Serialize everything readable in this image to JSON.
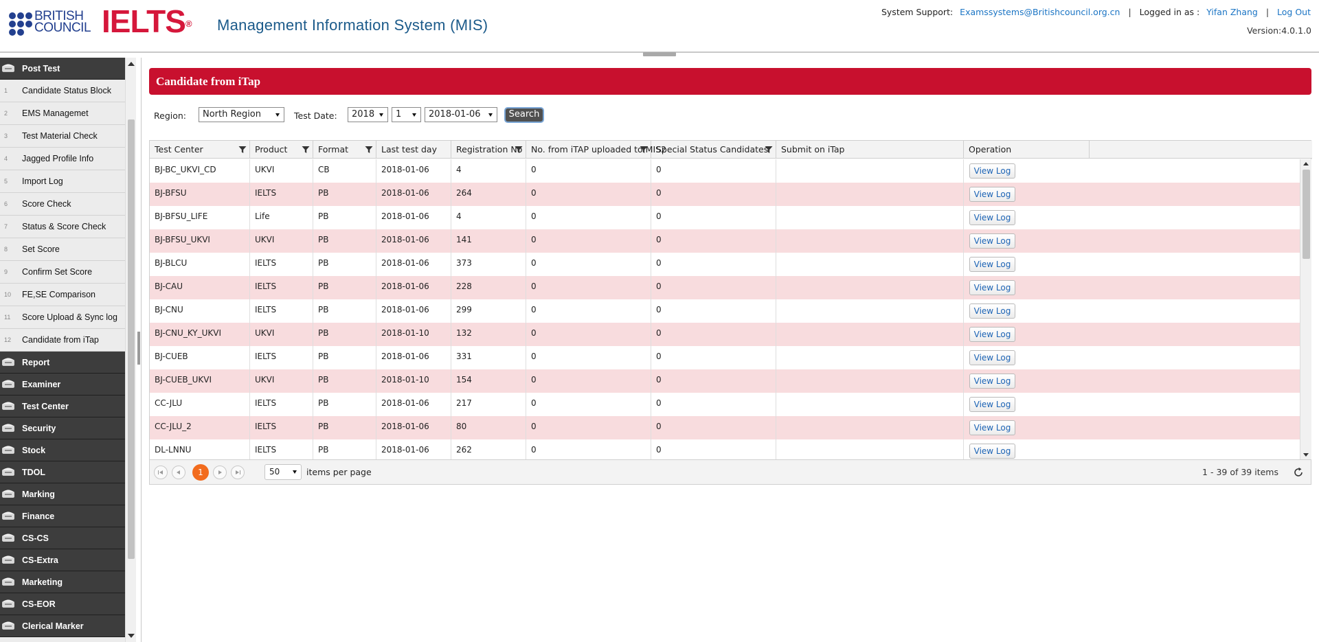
{
  "header": {
    "brand_line1": "BRITISH",
    "brand_line2": "COUNCIL",
    "ielts_logo": "IELTS",
    "ielts_mark": "®",
    "app_title": "Management Information System (MIS)",
    "support_label": "System Support:",
    "support_email": "Examssystems@Britishcouncil.org.cn",
    "sep1": "|",
    "logged_label": "Logged in as :",
    "user_name": "Yifan Zhang",
    "sep2": "|",
    "logout": "Log Out",
    "version": "Version:4.0.1.0"
  },
  "sidebar": {
    "post_test": "Post Test",
    "items": [
      {
        "num": "1",
        "label": "Candidate Status Block"
      },
      {
        "num": "2",
        "label": "EMS Managemet"
      },
      {
        "num": "3",
        "label": "Test Material Check"
      },
      {
        "num": "4",
        "label": "Jagged Profile Info"
      },
      {
        "num": "5",
        "label": "Import Log"
      },
      {
        "num": "6",
        "label": "Score Check"
      },
      {
        "num": "7",
        "label": "Status & Score Check"
      },
      {
        "num": "8",
        "label": "Set Score"
      },
      {
        "num": "9",
        "label": "Confirm Set Score"
      },
      {
        "num": "10",
        "label": "FE,SE Comparison"
      },
      {
        "num": "11",
        "label": "Score Upload & Sync log"
      },
      {
        "num": "12",
        "label": "Candidate from iTap"
      }
    ],
    "groups": [
      "Report",
      "Examiner",
      "Test Center",
      "Security",
      "Stock",
      "TDOL",
      "Marking",
      "Finance",
      "CS-CS",
      "CS-Extra",
      "Marketing",
      "CS-EOR",
      "Clerical Marker"
    ]
  },
  "page": {
    "title": "Candidate from iTap"
  },
  "filters": {
    "region_label": "Region:",
    "region_value": "North Region",
    "test_date_label": "Test Date:",
    "year_value": "2018",
    "month_value": "1",
    "date_value": "2018-01-06",
    "search_label": "Search"
  },
  "grid": {
    "columns": [
      "Test Center",
      "Product",
      "Format",
      "Last test day",
      "Registration No",
      "No. from iTAP uploaded to MIS2",
      "Special Status Candidates",
      "Submit on iTap",
      "Operation"
    ],
    "rows": [
      {
        "center": "BJ-BC_UKVI_CD",
        "product": "UKVI",
        "format": "CB",
        "last_day": "2018-01-06",
        "reg_no": "4",
        "uploaded": "0",
        "special": "0",
        "submit": "",
        "op": "View Log"
      },
      {
        "center": "BJ-BFSU",
        "product": "IELTS",
        "format": "PB",
        "last_day": "2018-01-06",
        "reg_no": "264",
        "uploaded": "0",
        "special": "0",
        "submit": "",
        "op": "View Log"
      },
      {
        "center": "BJ-BFSU_LIFE",
        "product": "Life",
        "format": "PB",
        "last_day": "2018-01-06",
        "reg_no": "4",
        "uploaded": "0",
        "special": "0",
        "submit": "",
        "op": "View Log"
      },
      {
        "center": "BJ-BFSU_UKVI",
        "product": "UKVI",
        "format": "PB",
        "last_day": "2018-01-06",
        "reg_no": "141",
        "uploaded": "0",
        "special": "0",
        "submit": "",
        "op": "View Log"
      },
      {
        "center": "BJ-BLCU",
        "product": "IELTS",
        "format": "PB",
        "last_day": "2018-01-06",
        "reg_no": "373",
        "uploaded": "0",
        "special": "0",
        "submit": "",
        "op": "View Log"
      },
      {
        "center": "BJ-CAU",
        "product": "IELTS",
        "format": "PB",
        "last_day": "2018-01-06",
        "reg_no": "228",
        "uploaded": "0",
        "special": "0",
        "submit": "",
        "op": "View Log"
      },
      {
        "center": "BJ-CNU",
        "product": "IELTS",
        "format": "PB",
        "last_day": "2018-01-06",
        "reg_no": "299",
        "uploaded": "0",
        "special": "0",
        "submit": "",
        "op": "View Log"
      },
      {
        "center": "BJ-CNU_KY_UKVI",
        "product": "UKVI",
        "format": "PB",
        "last_day": "2018-01-10",
        "reg_no": "132",
        "uploaded": "0",
        "special": "0",
        "submit": "",
        "op": "View Log"
      },
      {
        "center": "BJ-CUEB",
        "product": "IELTS",
        "format": "PB",
        "last_day": "2018-01-06",
        "reg_no": "331",
        "uploaded": "0",
        "special": "0",
        "submit": "",
        "op": "View Log"
      },
      {
        "center": "BJ-CUEB_UKVI",
        "product": "UKVI",
        "format": "PB",
        "last_day": "2018-01-10",
        "reg_no": "154",
        "uploaded": "0",
        "special": "0",
        "submit": "",
        "op": "View Log"
      },
      {
        "center": "CC-JLU",
        "product": "IELTS",
        "format": "PB",
        "last_day": "2018-01-06",
        "reg_no": "217",
        "uploaded": "0",
        "special": "0",
        "submit": "",
        "op": "View Log"
      },
      {
        "center": "CC-JLU_2",
        "product": "IELTS",
        "format": "PB",
        "last_day": "2018-01-06",
        "reg_no": "80",
        "uploaded": "0",
        "special": "0",
        "submit": "",
        "op": "View Log"
      },
      {
        "center": "DL-LNNU",
        "product": "IELTS",
        "format": "PB",
        "last_day": "2018-01-06",
        "reg_no": "262",
        "uploaded": "0",
        "special": "0",
        "submit": "",
        "op": "View Log"
      }
    ]
  },
  "pager": {
    "current_page": "1",
    "per_page": "50",
    "per_page_label": "items per page",
    "info": "1 - 39 of 39 items"
  },
  "colors": {
    "title_bar": "#c8102e",
    "alt_row": "#f8dcde",
    "sidebar_group": "#3d3d3d",
    "pager_current": "#f26b1d",
    "link": "#1a74c4"
  }
}
